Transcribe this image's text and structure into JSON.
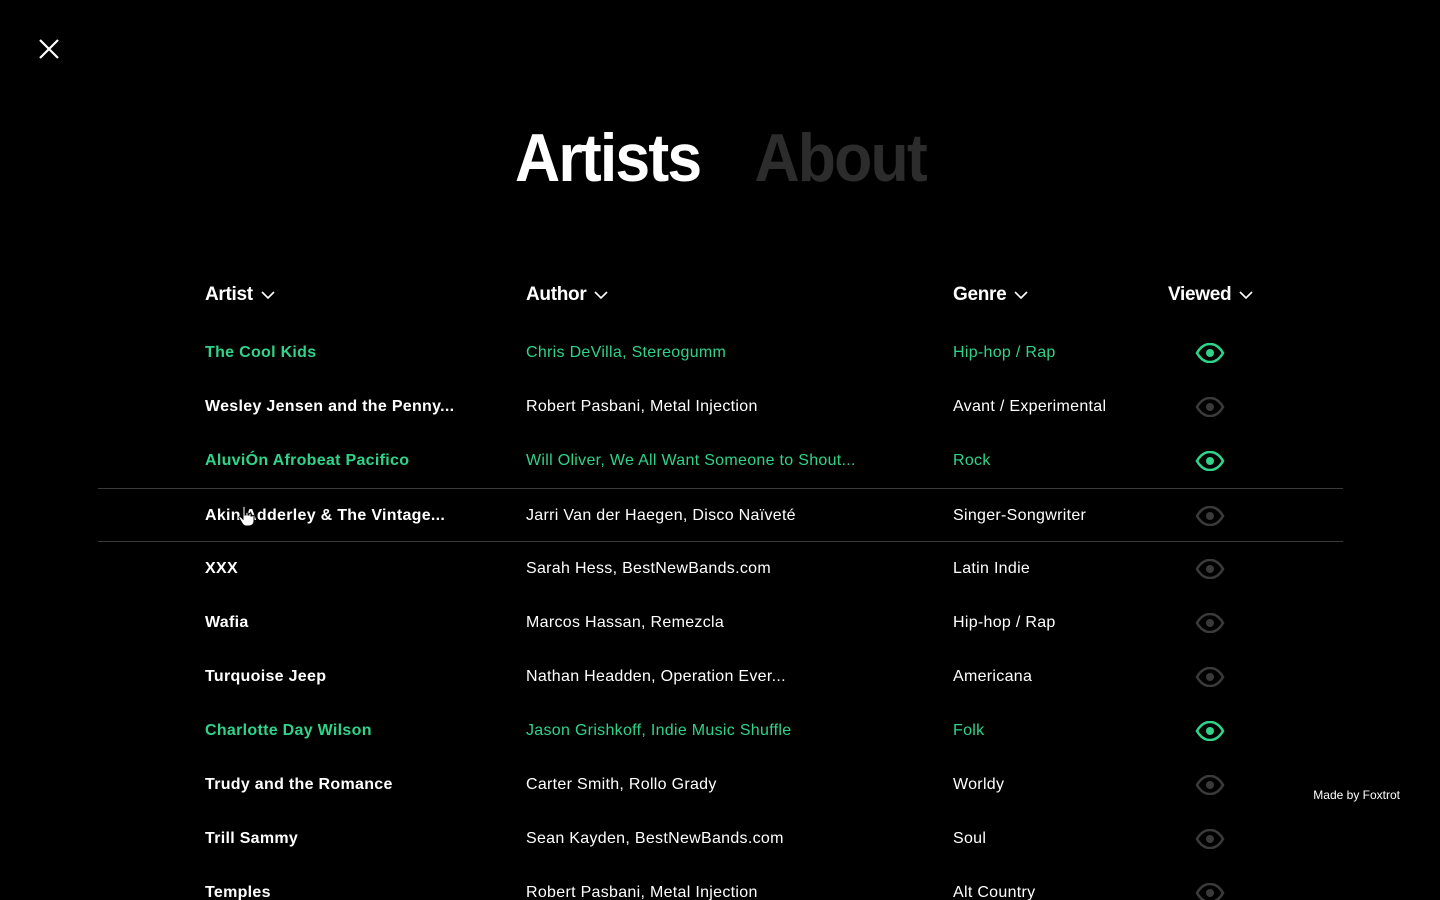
{
  "nav": {
    "tabs": [
      {
        "label": "Artists",
        "active": true
      },
      {
        "label": "About",
        "active": false
      }
    ]
  },
  "table": {
    "columns": {
      "artist": "Artist",
      "author": "Author",
      "genre": "Genre",
      "viewed": "Viewed"
    },
    "rows": [
      {
        "artist": "The Cool Kids",
        "author": "Chris DeVilla, Stereogumm",
        "genre": "Hip-hop / Rap",
        "viewed": true
      },
      {
        "artist": "Wesley Jensen and the Penny...",
        "author": "Robert Pasbani, Metal Injection",
        "genre": "Avant / Experimental",
        "viewed": false
      },
      {
        "artist": "AluviÓn Afrobeat Pacifico",
        "author": "Will Oliver, We All Want Someone to Shout...",
        "genre": "Rock",
        "viewed": true
      },
      {
        "artist": "Akin Adderley & The Vintage...",
        "author": "Jarri Van der Haegen, Disco Naïveté",
        "genre": "Singer-Songwriter",
        "viewed": false,
        "highlighted": true
      },
      {
        "artist": "XXX",
        "author": "Sarah Hess, BestNewBands.com",
        "genre": "Latin Indie",
        "viewed": false
      },
      {
        "artist": "Wafia",
        "author": "Marcos Hassan, Remezcla",
        "genre": "Hip-hop / Rap",
        "viewed": false
      },
      {
        "artist": "Turquoise Jeep",
        "author": "Nathan Headden, Operation Ever...",
        "genre": "Americana",
        "viewed": false
      },
      {
        "artist": "Charlotte Day Wilson",
        "author": "Jason Grishkoff, Indie Music Shuffle",
        "genre": "Folk",
        "viewed": true
      },
      {
        "artist": "Trudy and the Romance",
        "author": "Carter Smith, Rollo Grady",
        "genre": "Worldy",
        "viewed": false
      },
      {
        "artist": "Trill Sammy",
        "author": "Sean Kayden, BestNewBands.com",
        "genre": "Soul",
        "viewed": false
      },
      {
        "artist": "Temples",
        "author": "Robert Pasbani, Metal Injection",
        "genre": "Alt Country",
        "viewed": false
      }
    ]
  },
  "footer": {
    "credit": "Made by Foxtrot"
  },
  "icons": {
    "close": "close-icon",
    "sort": "chevron-down-icon",
    "viewed": "eye-icon"
  },
  "colors": {
    "background": "#000000",
    "accent": "#2fd38a",
    "inactive_tab": "#2c2c2c",
    "unviewed_eye": "#3a3a3a"
  }
}
